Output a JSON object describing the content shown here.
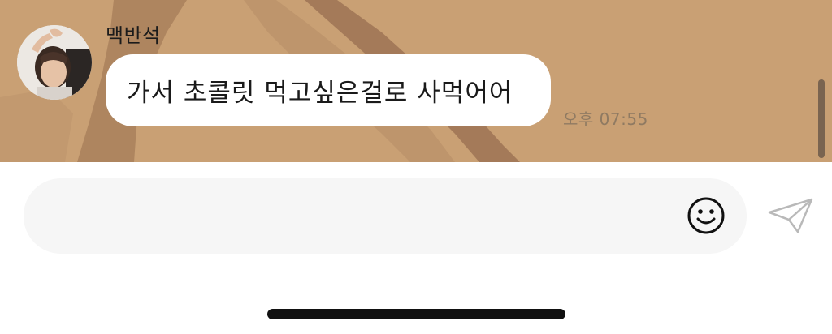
{
  "chat": {
    "sender_name": "맥반석",
    "message_text": "가서 초콜릿 먹고싶은걸로 사먹어어",
    "message_time": "오후 07:55"
  },
  "composer": {
    "input_value": "",
    "emoji_icon": "smiley-face-icon",
    "send_icon": "paper-plane-icon"
  },
  "colors": {
    "chat_background": "#c79f73",
    "bubble": "#ffffff",
    "input_background": "#f6f6f6"
  }
}
